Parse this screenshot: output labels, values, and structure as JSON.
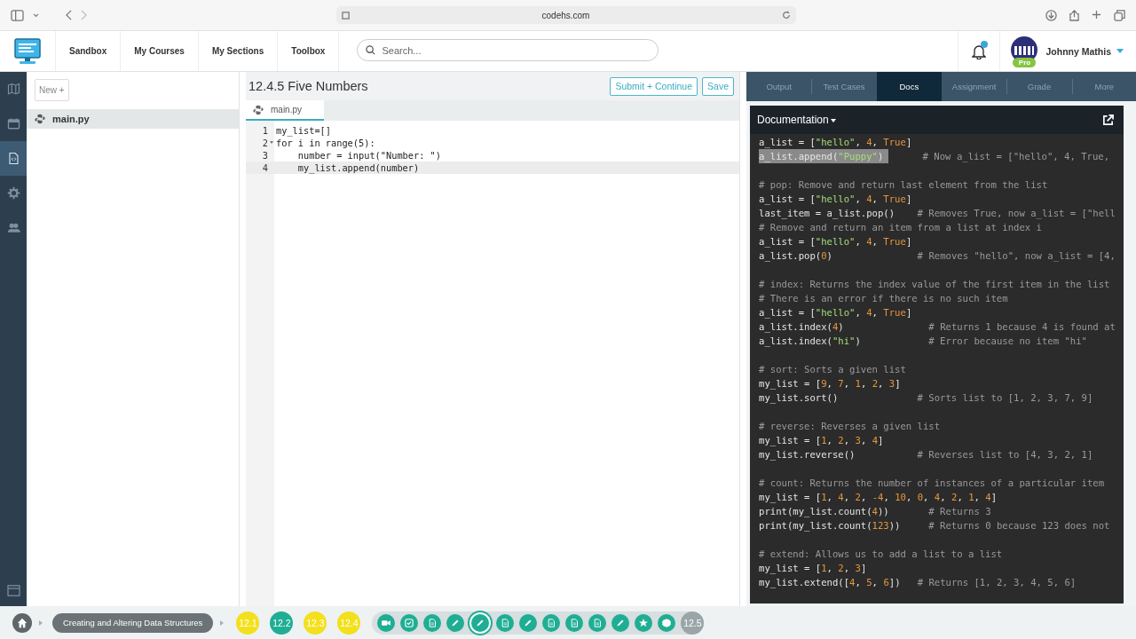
{
  "browser": {
    "url": "codehs.com"
  },
  "header": {
    "nav": [
      "Sandbox",
      "My Courses",
      "My Sections",
      "Toolbox"
    ],
    "search": {
      "placeholder": "Search..."
    },
    "notifications": {
      "unread": true
    },
    "user": {
      "name": "Johnny Mathis",
      "badge": "Pro"
    }
  },
  "rail": [
    {
      "kind": "map",
      "selected": false
    },
    {
      "kind": "calendar",
      "selected": false
    },
    {
      "kind": "code",
      "selected": true
    },
    {
      "kind": "gear",
      "selected": false
    },
    {
      "kind": "people",
      "selected": false
    }
  ],
  "files": {
    "new_button": "New +",
    "items": [
      {
        "name": "main.py",
        "selected": true
      }
    ]
  },
  "editor": {
    "title": "12.4.5 Five Numbers",
    "buttons": [
      "Submit + Continue",
      "Save"
    ],
    "tab": "main.py",
    "lines": [
      {
        "number": "1",
        "text": "my_list=[]",
        "active": false,
        "foldable": false
      },
      {
        "number": "2",
        "text": "for i in range(5):",
        "active": false,
        "foldable": true
      },
      {
        "number": "3",
        "text": "    number = input(\"Number: \")",
        "active": false,
        "foldable": false
      },
      {
        "number": "4",
        "text": "    my_list.append(number)",
        "active": true,
        "foldable": false
      }
    ]
  },
  "panel": {
    "tabs": [
      {
        "label": "Output",
        "selected": false
      },
      {
        "label": "Test Cases",
        "selected": false
      },
      {
        "label": "Docs",
        "selected": true
      },
      {
        "label": "Assignment",
        "selected": false
      },
      {
        "label": "Grade",
        "selected": false
      },
      {
        "label": "More",
        "selected": false
      }
    ],
    "docs_title": "Documentation",
    "blocks": [
      [
        {
          "code": "a_list = [\"hello\", 4, True]"
        },
        {
          "code": "a_list.append(\"Puppy\")",
          "selected": true,
          "comment": "      # Now a_list = [\"hello\", 4, True,"
        }
      ],
      [
        {
          "comment": "# pop: Remove and return last element from the list"
        },
        {
          "code": "a_list = [\"hello\", 4, True]"
        },
        {
          "code": "last_item = a_list.pop()",
          "comment": "    # Removes True, now a_list = [\"hell"
        },
        {
          "comment": "# Remove and return an item from a list at index i"
        },
        {
          "code": "a_list = [\"hello\", 4, True]"
        },
        {
          "code": "a_list.pop(0)",
          "comment": "               # Removes \"hello\", now a_list = [4,"
        }
      ],
      [
        {
          "comment": "# index: Returns the index value of the first item in the list"
        },
        {
          "comment": "# There is an error if there is no such item"
        },
        {
          "code": "a_list = [\"hello\", 4, True]"
        },
        {
          "code": "a_list.index(4)",
          "comment": "               # Returns 1 because 4 is found at"
        },
        {
          "code": "a_list.index(\"hi\")",
          "comment": "            # Error because no item \"hi\""
        }
      ],
      [
        {
          "comment": "# sort: Sorts a given list"
        },
        {
          "code": "my_list = [9, 7, 1, 2, 3]"
        },
        {
          "code": "my_list.sort()",
          "comment": "              # Sorts list to [1, 2, 3, 7, 9]"
        }
      ],
      [
        {
          "comment": "# reverse: Reverses a given list"
        },
        {
          "code": "my_list = [1, 2, 3, 4]"
        },
        {
          "code": "my_list.reverse()",
          "comment": "           # Reverses list to [4, 3, 2, 1]"
        }
      ],
      [
        {
          "comment": "# count: Returns the number of instances of a particular item"
        },
        {
          "code": "my_list = [1, 4, 2, -4, 10, 0, 4, 2, 1, 4]"
        },
        {
          "code": "print(my_list.count(4))",
          "comment": "       # Returns 3"
        },
        {
          "code": "print(my_list.count(123))",
          "comment": "     # Returns 0 because 123 does not"
        }
      ],
      [
        {
          "comment": "# extend: Allows us to add a list to a list"
        },
        {
          "code": "my_list = [1, 2, 3]"
        },
        {
          "code": "my_list.extend([4, 5, 6])",
          "comment": "   # Returns [1, 2, 3, 4, 5, 6]"
        }
      ]
    ]
  },
  "progress": {
    "unit": "Creating and Altering Data Structures",
    "lessons": [
      {
        "label": "12.1",
        "color": "#f3e01c"
      },
      {
        "label": "12.2",
        "color": "#1fae94"
      },
      {
        "label": "12.3",
        "color": "#f3e01c"
      },
      {
        "label": "12.4",
        "color": "#f3e01c"
      }
    ],
    "activities": [
      {
        "kind": "video",
        "current": false
      },
      {
        "kind": "check",
        "current": false
      },
      {
        "kind": "doc",
        "current": false
      },
      {
        "kind": "pencil",
        "current": false
      },
      {
        "kind": "pencil",
        "current": true
      },
      {
        "kind": "doc",
        "current": false
      },
      {
        "kind": "pencil",
        "current": false
      },
      {
        "kind": "doc",
        "current": false
      },
      {
        "kind": "doc",
        "current": false
      },
      {
        "kind": "doc",
        "current": false
      },
      {
        "kind": "pencil",
        "current": false
      },
      {
        "kind": "star",
        "current": false
      },
      {
        "kind": "badge",
        "current": false
      }
    ],
    "next_lesson": {
      "label": "12.5",
      "color": "#9aa5a8"
    }
  }
}
